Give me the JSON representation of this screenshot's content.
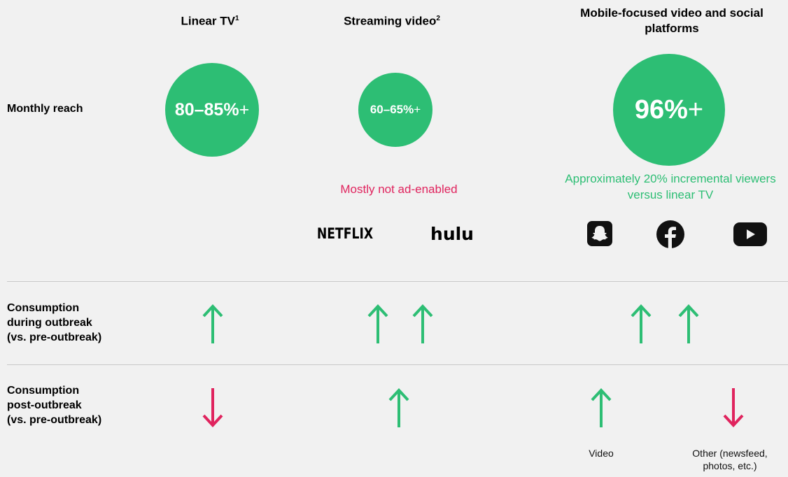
{
  "columns": {
    "linear_tv": {
      "title": "Linear TV",
      "sup": "1"
    },
    "streaming": {
      "title": "Streaming video",
      "sup": "2"
    },
    "mobile": {
      "title": "Mobile-focused video and social platforms"
    }
  },
  "rows": {
    "reach": "Monthly reach",
    "during": {
      "line1": "Consumption",
      "line2": "during outbreak",
      "line3": "(vs. pre-outbreak)"
    },
    "post": {
      "line1": "Consumption",
      "line2": "post-outbreak",
      "line3": "(vs. pre-outbreak)"
    }
  },
  "reach": {
    "linear_tv": {
      "value": "80–85%",
      "plus": "+"
    },
    "streaming": {
      "value": "60–65%",
      "plus": "+"
    },
    "mobile": {
      "value": "96%",
      "plus": "+"
    }
  },
  "notes": {
    "streaming": "Mostly not ad-enabled",
    "mobile": "Approximately 20% incremental viewers versus linear TV"
  },
  "logos": {
    "netflix": "NETFLIX",
    "hulu": "hulu"
  },
  "captions": {
    "video": "Video",
    "other": "Other (newsfeed, photos, etc.)"
  },
  "trends": {
    "during": {
      "linear_tv": "up",
      "streaming": [
        "up",
        "up"
      ],
      "mobile": [
        "up",
        "up"
      ]
    },
    "post": {
      "linear_tv": "down",
      "streaming": "up",
      "mobile_video": "up",
      "mobile_other": "down"
    }
  },
  "colors": {
    "green": "#2dbe74",
    "red": "#e0245e",
    "background": "#f1f1f1"
  },
  "icons": [
    "snapchat-icon",
    "facebook-icon",
    "youtube-icon",
    "up-arrow-icon",
    "down-arrow-icon"
  ]
}
